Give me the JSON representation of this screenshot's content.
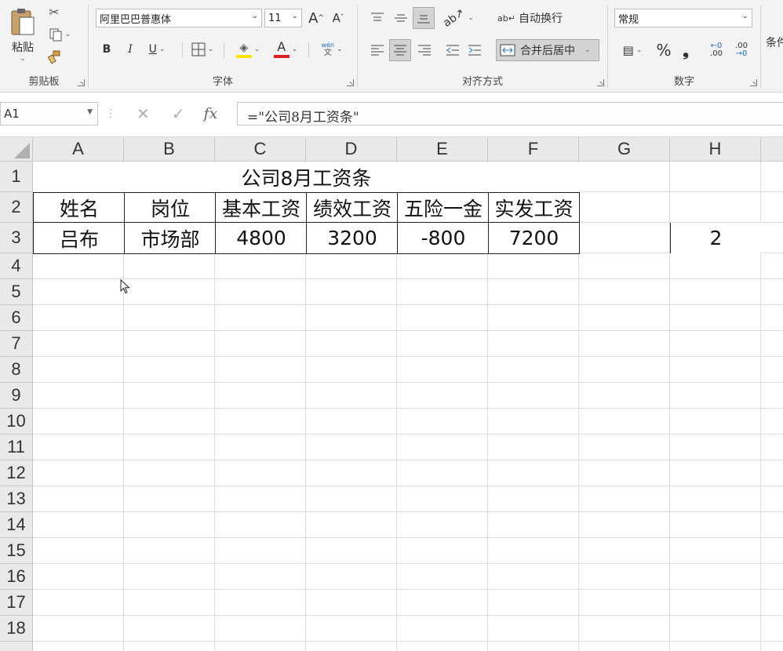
{
  "ribbon": {
    "clipboard": {
      "paste_label": "粘贴",
      "group_label": "剪贴板"
    },
    "font": {
      "font_name": "阿里巴巴普惠体",
      "font_size": "11",
      "grow_label": "A",
      "shrink_label": "A",
      "bold_label": "B",
      "italic_label": "I",
      "underline_label": "U",
      "font_color_label": "A",
      "phonetic_top": "wén",
      "phonetic_bottom": "文",
      "group_label": "字体"
    },
    "alignment": {
      "wrap_text_label": "自动换行",
      "merge_center_label": "合并后居中",
      "group_label": "对齐方式"
    },
    "number": {
      "format_value": "常规",
      "percent_label": "%",
      "comma_label": "❟",
      "increase_decimal_top": "←0",
      "increase_decimal_bottom": ".00",
      "decrease_decimal_top": ".00",
      "decrease_decimal_bottom": "→0",
      "group_label": "数字"
    },
    "styles": {
      "conditional_label": "条件"
    }
  },
  "formula_bar": {
    "name_box": "A1",
    "cancel_icon": "✕",
    "enter_icon": "✓",
    "fx_label": "fx",
    "formula": "=\"公司8月工资条\""
  },
  "columns": [
    "A",
    "B",
    "C",
    "D",
    "E",
    "F",
    "G",
    "H"
  ],
  "rows": [
    "1",
    "2",
    "3",
    "4",
    "5",
    "6",
    "7",
    "8",
    "9",
    "10",
    "11",
    "12",
    "13",
    "14",
    "15",
    "16",
    "17",
    "18"
  ],
  "sheet": {
    "title": "公司8月工资条",
    "headers": [
      "姓名",
      "岗位",
      "基本工资",
      "绩效工资",
      "五险一金",
      "实发工资"
    ],
    "record": [
      "吕布",
      "市场部",
      "4800",
      "3200",
      "-800",
      "7200"
    ],
    "h3": "2"
  },
  "colors": {
    "font_color_bar": "#e02020",
    "fill_color_bar": "#ffe400",
    "grid_line": "#dedede"
  }
}
